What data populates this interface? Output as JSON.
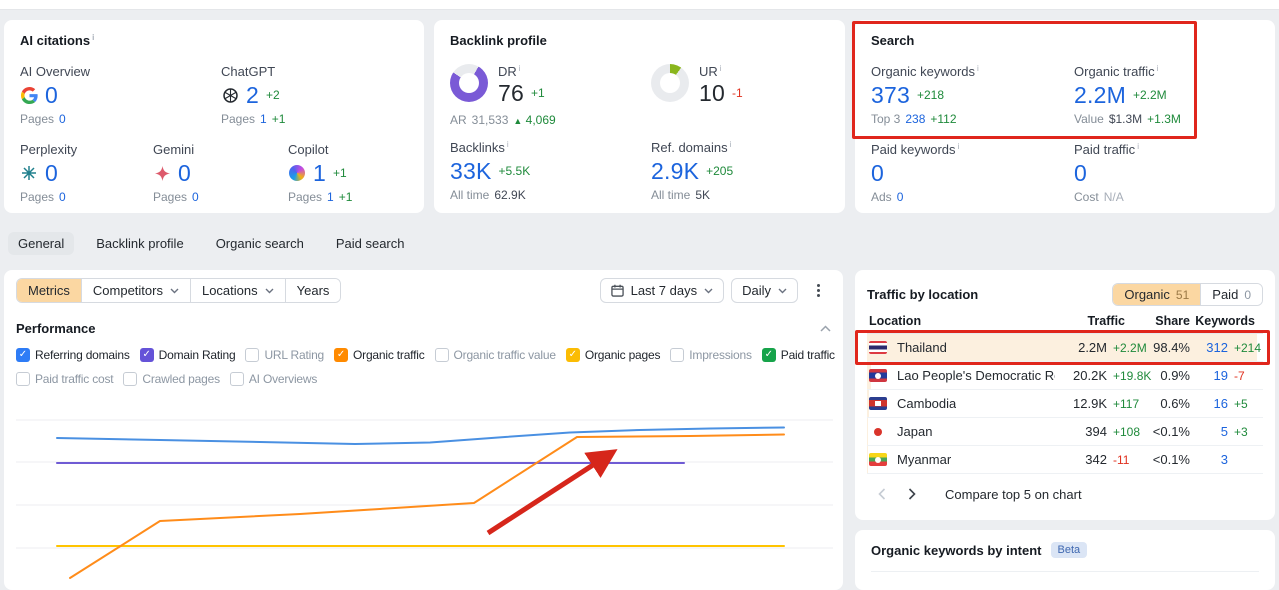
{
  "colors": {
    "accent_blue": "#1c64dd",
    "green": "#1f8a3b",
    "red": "#e0301e",
    "annotation_red": "#e0261c",
    "peach_active": "#fbd7a2",
    "share_bar": "#fcf0df",
    "dr_donut": "#7a5ad6",
    "ur_donut": "#8ab61d"
  },
  "ai_citations": {
    "title": "AI citations",
    "row1": [
      {
        "label": "AI Overview",
        "icon": "google-icon",
        "value": "0",
        "delta": "",
        "sub_label": "Pages",
        "sub_value": "0",
        "sub_delta": "",
        "sub_style": "blue"
      },
      {
        "label": "ChatGPT",
        "icon": "openai-icon",
        "value": "2",
        "delta": "+2",
        "sub_label": "Pages",
        "sub_value": "1",
        "sub_delta": "+1",
        "sub_style": "blue"
      }
    ],
    "row2": [
      {
        "label": "Perplexity",
        "icon": "perplexity-icon",
        "value": "0",
        "delta": "",
        "sub_label": "Pages",
        "sub_value": "0",
        "sub_delta": "",
        "sub_style": "blue"
      },
      {
        "label": "Gemini",
        "icon": "gemini-icon",
        "value": "0",
        "delta": "",
        "sub_label": "Pages",
        "sub_value": "0",
        "sub_delta": "",
        "sub_style": "blue"
      },
      {
        "label": "Copilot",
        "icon": "copilot-icon",
        "value": "1",
        "delta": "+1",
        "sub_label": "Pages",
        "sub_value": "1",
        "sub_delta": "+1",
        "sub_style": "blue"
      }
    ]
  },
  "backlink_profile": {
    "title": "Backlink profile",
    "dr": {
      "label": "DR",
      "value": "76",
      "delta": "+1",
      "percent": 76
    },
    "ur": {
      "label": "UR",
      "value": "10",
      "delta": "-1",
      "percent": 10
    },
    "ar": {
      "label": "AR",
      "value": "31,533",
      "delta": "4,069"
    },
    "row2": [
      {
        "label": "Backlinks",
        "info": true,
        "value": "33K",
        "delta": "+5.5K",
        "sub_label": "All time",
        "sub_value": "62.9K",
        "sub_delta": "",
        "sub_style": "dark"
      },
      {
        "label": "Ref. domains",
        "info": true,
        "value": "2.9K",
        "delta": "+205",
        "sub_label": "All time",
        "sub_value": "5K",
        "sub_delta": "",
        "sub_style": "dark"
      }
    ]
  },
  "search": {
    "title": "Search",
    "row1": [
      {
        "label": "Organic keywords",
        "info": true,
        "value": "373",
        "delta": "+218",
        "sub_label": "Top 3",
        "sub_value": "238",
        "sub_delta": "+112",
        "sub_style": "blue"
      },
      {
        "label": "Organic traffic",
        "info": true,
        "value": "2.2M",
        "delta": "+2.2M",
        "sub_label": "Value",
        "sub_value": "$1.3M",
        "sub_delta": "+1.3M",
        "sub_style": "dark"
      }
    ],
    "row2": [
      {
        "label": "Paid keywords",
        "info": true,
        "value": "0",
        "delta": "",
        "sub_label": "Ads",
        "sub_value": "0",
        "sub_delta": "",
        "sub_style": "blue"
      },
      {
        "label": "Paid traffic",
        "info": true,
        "value": "0",
        "delta": "",
        "sub_label": "Cost",
        "sub_value": "N/A",
        "sub_delta": "",
        "sub_style": "muted"
      }
    ]
  },
  "tabs": {
    "items": [
      {
        "label": "General"
      },
      {
        "label": "Backlink profile"
      },
      {
        "label": "Organic search"
      },
      {
        "label": "Paid search"
      }
    ],
    "active_index": 0
  },
  "filters": {
    "metrics": "Metrics",
    "competitors": "Competitors",
    "locations": "Locations",
    "years": "Years",
    "date_range": "Last 7 days",
    "granularity": "Daily"
  },
  "performance": {
    "title": "Performance",
    "checkboxes": [
      {
        "label": "Referring domains",
        "checked": true,
        "color": "#2e7cf6"
      },
      {
        "label": "Domain Rating",
        "checked": true,
        "color": "#6553d8"
      },
      {
        "label": "URL Rating",
        "checked": false
      },
      {
        "label": "Organic traffic",
        "checked": true,
        "color": "#ff8a00"
      },
      {
        "label": "Organic traffic value",
        "checked": false
      },
      {
        "label": "Organic pages",
        "checked": true,
        "color": "#fbbc04"
      },
      {
        "label": "Impressions",
        "checked": false
      },
      {
        "label": "Paid traffic",
        "checked": true,
        "color": "#16a34a"
      },
      {
        "label": "Paid traffic cost",
        "checked": false
      },
      {
        "label": "Crawled pages",
        "checked": false
      },
      {
        "label": "AI Overviews",
        "checked": false
      }
    ]
  },
  "chart_data": {
    "type": "line",
    "note": "Axis labels are cropped out of the screenshot; point coordinates are pixel positions within the visible plot area (839x180).",
    "gridlines_y": [
      20,
      62,
      105,
      148
    ],
    "gridline_x_range": [
      12,
      829
    ],
    "series": [
      {
        "name": "Organic pages",
        "color": "#ffc400",
        "points": [
          [
            53,
            146
          ],
          [
            780,
            146
          ]
        ]
      },
      {
        "name": "Domain Rating",
        "color": "#6f5bd4",
        "points": [
          [
            53,
            63
          ],
          [
            680,
            63
          ]
        ]
      },
      {
        "name": "Referring domains",
        "color": "#4a90e2",
        "points": [
          [
            53,
            38
          ],
          [
            156,
            40
          ],
          [
            256,
            42
          ],
          [
            351,
            44
          ],
          [
            426,
            42.5
          ],
          [
            501,
            37
          ],
          [
            566,
            32.5
          ],
          [
            636,
            30
          ],
          [
            706,
            28.5
          ],
          [
            780,
            27.5
          ]
        ]
      },
      {
        "name": "Organic traffic",
        "color": "#ff8c1a",
        "points": [
          [
            66,
            178
          ],
          [
            156,
            121
          ],
          [
            296,
            114
          ],
          [
            470,
            103
          ],
          [
            573,
            37
          ],
          [
            686,
            36
          ],
          [
            780,
            34.5
          ]
        ]
      }
    ],
    "annotation_arrow": {
      "from": [
        484,
        133
      ],
      "to": [
        606,
        54
      ],
      "color": "#d6261b"
    }
  },
  "traffic_by_location": {
    "title": "Traffic by location",
    "toggle": {
      "organic_label": "Organic",
      "organic_count": "51",
      "paid_label": "Paid",
      "paid_count": "0"
    },
    "columns": {
      "location": "Location",
      "traffic": "Traffic",
      "share": "Share",
      "keywords": "Keywords"
    },
    "rows": [
      {
        "flag": "th",
        "name": "Thailand",
        "traffic": "2.2M",
        "traffic_delta": "+2.2M",
        "share": "98.4%",
        "share_pct": 98.4,
        "keywords": "312",
        "keywords_delta": "+214"
      },
      {
        "flag": "la",
        "name": "Lao People's Democratic Reput",
        "traffic": "20.2K",
        "traffic_delta": "+19.8K",
        "share": "0.9%",
        "share_pct": 0.9,
        "keywords": "19",
        "keywords_delta": "-7"
      },
      {
        "flag": "kh",
        "name": "Cambodia",
        "traffic": "12.9K",
        "traffic_delta": "+117",
        "share": "0.6%",
        "share_pct": 0.6,
        "keywords": "16",
        "keywords_delta": "+5"
      },
      {
        "flag": "jp",
        "name": "Japan",
        "traffic": "394",
        "traffic_delta": "+108",
        "share": "<0.1%",
        "share_pct": 0.05,
        "keywords": "5",
        "keywords_delta": "+3"
      },
      {
        "flag": "mm",
        "name": "Myanmar",
        "traffic": "342",
        "traffic_delta": "-11",
        "share": "<0.1%",
        "share_pct": 0.05,
        "keywords": "3",
        "keywords_delta": ""
      }
    ],
    "compare_label": "Compare top 5 on chart"
  },
  "intent": {
    "title": "Organic keywords by intent",
    "badge": "Beta"
  }
}
